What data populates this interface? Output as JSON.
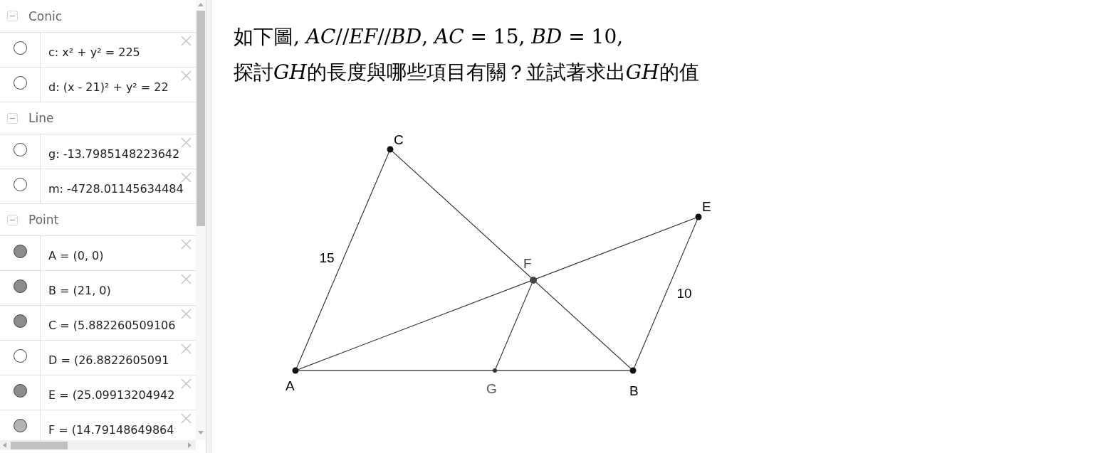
{
  "algebra": {
    "groups": [
      {
        "title": "Conic",
        "expanded": true,
        "items": [
          {
            "text": "c: x² + y² = 225",
            "visible": false
          },
          {
            "text": "d: (x - 21)² + y² = 22",
            "visible": false
          }
        ]
      },
      {
        "title": "Line",
        "expanded": true,
        "items": [
          {
            "text": "g: -13.7985148223642",
            "visible": false
          },
          {
            "text": "m: -4728.01145634484",
            "visible": false
          }
        ]
      },
      {
        "title": "Point",
        "expanded": true,
        "items": [
          {
            "text": "A = (0, 0)",
            "visible": true,
            "color": "#8c8c8c"
          },
          {
            "text": "B = (21, 0)",
            "visible": true,
            "color": "#8c8c8c"
          },
          {
            "text": "C = (5.882260509106",
            "visible": true,
            "color": "#8c8c8c"
          },
          {
            "text": "D = (26.8822605091",
            "visible": false
          },
          {
            "text": "E = (25.09913204942",
            "visible": true,
            "color": "#8c8c8c"
          },
          {
            "text": "F = (14.79148649864",
            "visible": true,
            "color": "#b4b4b4"
          }
        ]
      }
    ]
  },
  "problem": {
    "lines": [
      [
        {
          "text": "如下圖, ",
          "italic": false
        },
        {
          "text": "AC",
          "italic": true
        },
        {
          "text": "//",
          "italic": false
        },
        {
          "text": "EF",
          "italic": true
        },
        {
          "text": "//",
          "italic": false
        },
        {
          "text": "BD",
          "italic": true
        },
        {
          "text": ", ",
          "italic": false
        },
        {
          "text": "AC",
          "italic": true
        },
        {
          "text": " = 15, ",
          "italic": false
        },
        {
          "text": "BD",
          "italic": true
        },
        {
          "text": " = 10,",
          "italic": false
        }
      ],
      [
        {
          "text": "探討",
          "italic": false
        },
        {
          "text": "GH",
          "italic": true
        },
        {
          "text": "的長度與哪些項目有關？並試著求出",
          "italic": false
        },
        {
          "text": "GH",
          "italic": true
        },
        {
          "text": "的值",
          "italic": false
        }
      ]
    ]
  },
  "figure": {
    "points": [
      {
        "label": "C",
        "kind": "free"
      },
      {
        "label": "E",
        "kind": "free"
      },
      {
        "label": "F",
        "kind": "intersection"
      },
      {
        "label": "A",
        "kind": "free"
      },
      {
        "label": "G",
        "kind": "on-path"
      },
      {
        "label": "B",
        "kind": "free"
      }
    ],
    "segment_labels": [
      {
        "text": "15"
      },
      {
        "text": "10"
      }
    ]
  }
}
